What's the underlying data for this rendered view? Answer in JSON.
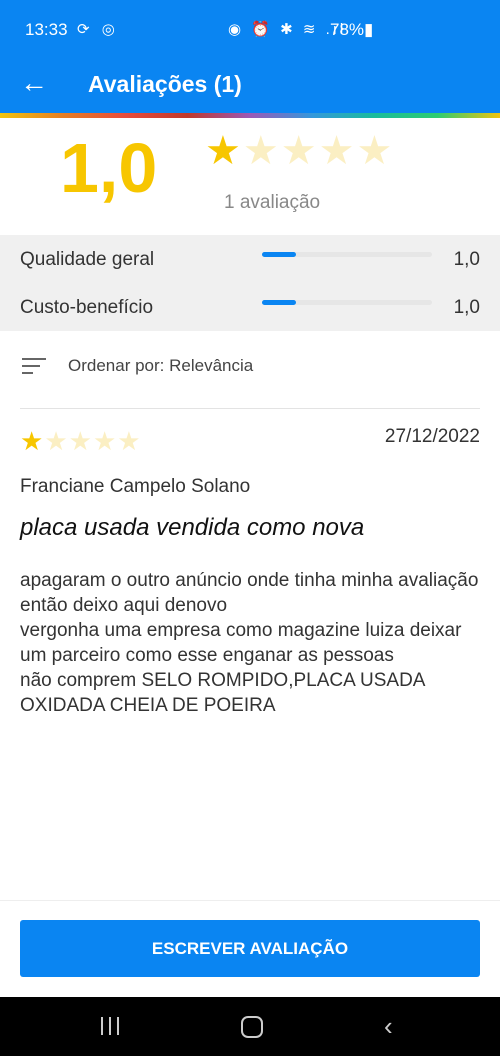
{
  "status_bar": {
    "time": "13:33",
    "left_icons": "⟳ ◎",
    "right_icons": "◉ ⏰ ✱ ≋ .ıl",
    "battery": "78%▮"
  },
  "app_bar": {
    "back_icon": "←",
    "title": "Avaliações (1)"
  },
  "summary": {
    "rating": "1,0",
    "stars_filled": 1,
    "stars_total": 5,
    "count_label": "1 avaliação"
  },
  "criteria": [
    {
      "label": "Qualidade geral",
      "value": "1,0",
      "fraction": 0.2
    },
    {
      "label": "Custo-benefício",
      "value": "1,0",
      "fraction": 0.2
    }
  ],
  "sort": {
    "label": "Ordenar por: Relevância"
  },
  "review": {
    "stars_filled": 1,
    "stars_total": 5,
    "date": "27/12/2022",
    "author": "Franciane Campelo Solano",
    "title": "placa usada vendida como nova",
    "body": "apagaram o outro anúncio onde tinha minha avaliação\nentão deixo aqui denovo\nvergonha uma empresa como magazine luiza deixar um parceiro como esse enganar as pessoas\nnão comprem SELO ROMPIDO,PLACA USADA OXIDADA CHEIA DE POEIRA"
  },
  "write_button": {
    "label": "ESCREVER AVALIAÇÃO"
  },
  "nav": {
    "back_icon": "‹"
  },
  "colors": {
    "primary": "#0a85f2",
    "star": "#f7c600",
    "star_empty": "#fbefc3"
  }
}
